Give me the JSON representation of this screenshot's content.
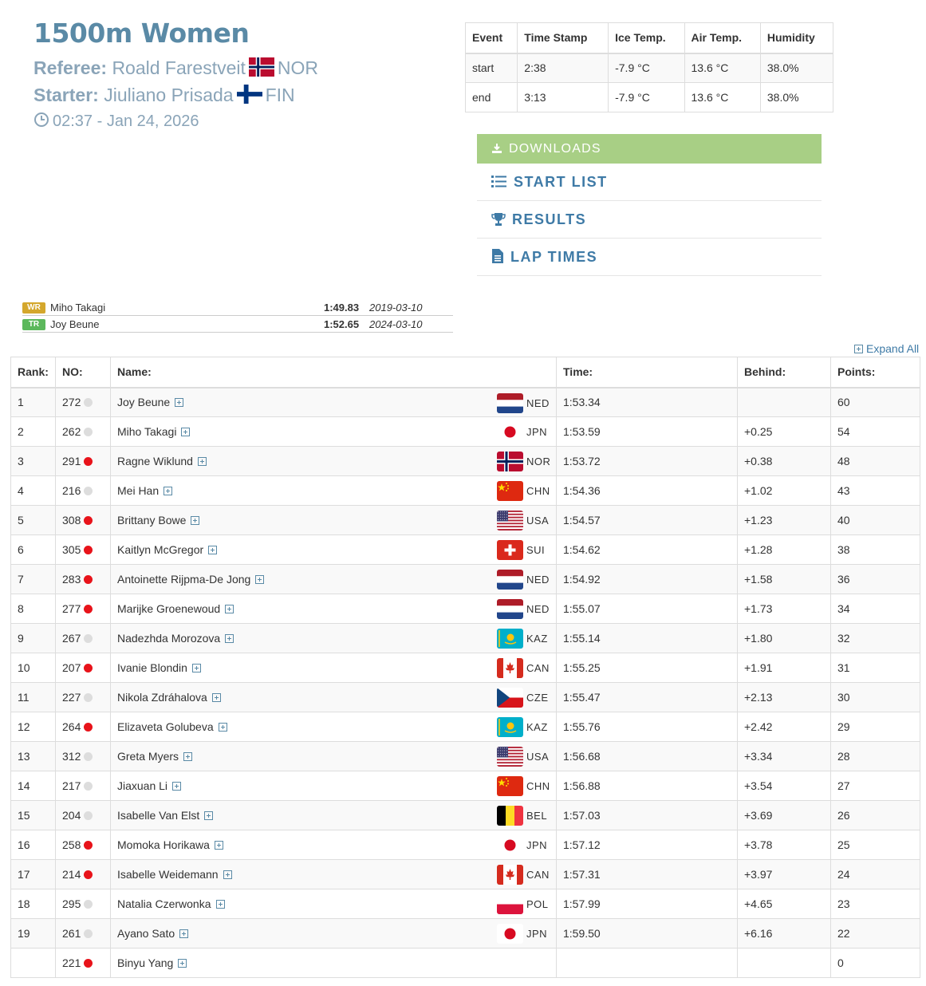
{
  "event": {
    "title": "1500m Women",
    "referee_label": "Referee:",
    "referee_name": "Roald Farestveit",
    "referee_country": "NOR",
    "starter_label": "Starter:",
    "starter_name": "Jiuliano Prisada",
    "starter_country": "FIN",
    "datetime": "02:37 - Jan 24, 2026"
  },
  "conditions": {
    "headers": [
      "Event",
      "Time Stamp",
      "Ice Temp.",
      "Air Temp.",
      "Humidity"
    ],
    "rows": [
      [
        "start",
        "2:38",
        "-7.9 °C",
        "13.6 °C",
        "38.0%"
      ],
      [
        "end",
        "3:13",
        "-7.9 °C",
        "13.6 °C",
        "38.0%"
      ]
    ]
  },
  "downloads": {
    "title": "DOWNLOADS",
    "start_list": "START LIST",
    "results": "RESULTS",
    "lap_times": "LAP TIMES"
  },
  "records": [
    {
      "badge": "WR",
      "color": "#d4a72c",
      "name": "Miho Takagi",
      "time": "1:49.83",
      "date": "2019-03-10"
    },
    {
      "badge": "TR",
      "color": "#5cb85c",
      "name": "Joy Beune",
      "time": "1:52.65",
      "date": "2024-03-10"
    }
  ],
  "expand_all": "Expand All",
  "results": {
    "headers": {
      "rank": "Rank:",
      "no": "NO:",
      "name": "Name:",
      "time": "Time:",
      "behind": "Behind:",
      "points": "Points:"
    },
    "rows": [
      {
        "rank": "1",
        "no": "272",
        "dot": "#dddddd",
        "name": "Joy Beune",
        "flag": "NED",
        "country": "NED",
        "time": "1:53.34",
        "behind": "",
        "points": "60"
      },
      {
        "rank": "2",
        "no": "262",
        "dot": "#dddddd",
        "name": "Miho Takagi",
        "flag": "JPN",
        "country": "JPN",
        "time": "1:53.59",
        "behind": "+0.25",
        "points": "54"
      },
      {
        "rank": "3",
        "no": "291",
        "dot": "#e8131a",
        "name": "Ragne Wiklund",
        "flag": "NOR",
        "country": "NOR",
        "time": "1:53.72",
        "behind": "+0.38",
        "points": "48"
      },
      {
        "rank": "4",
        "no": "216",
        "dot": "#dddddd",
        "name": "Mei Han",
        "flag": "CHN",
        "country": "CHN",
        "time": "1:54.36",
        "behind": "+1.02",
        "points": "43"
      },
      {
        "rank": "5",
        "no": "308",
        "dot": "#e8131a",
        "name": "Brittany Bowe",
        "flag": "USA",
        "country": "USA",
        "time": "1:54.57",
        "behind": "+1.23",
        "points": "40"
      },
      {
        "rank": "6",
        "no": "305",
        "dot": "#e8131a",
        "name": "Kaitlyn McGregor",
        "flag": "SUI",
        "country": "SUI",
        "time": "1:54.62",
        "behind": "+1.28",
        "points": "38"
      },
      {
        "rank": "7",
        "no": "283",
        "dot": "#e8131a",
        "name": "Antoinette Rijpma-De Jong",
        "flag": "NED",
        "country": "NED",
        "time": "1:54.92",
        "behind": "+1.58",
        "points": "36"
      },
      {
        "rank": "8",
        "no": "277",
        "dot": "#e8131a",
        "name": "Marijke Groenewoud",
        "flag": "NED",
        "country": "NED",
        "time": "1:55.07",
        "behind": "+1.73",
        "points": "34"
      },
      {
        "rank": "9",
        "no": "267",
        "dot": "#dddddd",
        "name": "Nadezhda Morozova",
        "flag": "KAZ",
        "country": "KAZ",
        "time": "1:55.14",
        "behind": "+1.80",
        "points": "32"
      },
      {
        "rank": "10",
        "no": "207",
        "dot": "#e8131a",
        "name": "Ivanie Blondin",
        "flag": "CAN",
        "country": "CAN",
        "time": "1:55.25",
        "behind": "+1.91",
        "points": "31"
      },
      {
        "rank": "11",
        "no": "227",
        "dot": "#dddddd",
        "name": "Nikola Zdráhalova",
        "flag": "CZE",
        "country": "CZE",
        "time": "1:55.47",
        "behind": "+2.13",
        "points": "30"
      },
      {
        "rank": "12",
        "no": "264",
        "dot": "#e8131a",
        "name": "Elizaveta Golubeva",
        "flag": "KAZ",
        "country": "KAZ",
        "time": "1:55.76",
        "behind": "+2.42",
        "points": "29"
      },
      {
        "rank": "13",
        "no": "312",
        "dot": "#dddddd",
        "name": "Greta Myers",
        "flag": "USA",
        "country": "USA",
        "time": "1:56.68",
        "behind": "+3.34",
        "points": "28"
      },
      {
        "rank": "14",
        "no": "217",
        "dot": "#dddddd",
        "name": "Jiaxuan Li",
        "flag": "CHN",
        "country": "CHN",
        "time": "1:56.88",
        "behind": "+3.54",
        "points": "27"
      },
      {
        "rank": "15",
        "no": "204",
        "dot": "#dddddd",
        "name": "Isabelle Van Elst",
        "flag": "BEL",
        "country": "BEL",
        "time": "1:57.03",
        "behind": "+3.69",
        "points": "26"
      },
      {
        "rank": "16",
        "no": "258",
        "dot": "#e8131a",
        "name": "Momoka Horikawa",
        "flag": "JPN",
        "country": "JPN",
        "time": "1:57.12",
        "behind": "+3.78",
        "points": "25"
      },
      {
        "rank": "17",
        "no": "214",
        "dot": "#e8131a",
        "name": "Isabelle Weidemann",
        "flag": "CAN",
        "country": "CAN",
        "time": "1:57.31",
        "behind": "+3.97",
        "points": "24"
      },
      {
        "rank": "18",
        "no": "295",
        "dot": "#dddddd",
        "name": "Natalia Czerwonka",
        "flag": "POL",
        "country": "POL",
        "time": "1:57.99",
        "behind": "+4.65",
        "points": "23"
      },
      {
        "rank": "19",
        "no": "261",
        "dot": "#dddddd",
        "name": "Ayano Sato",
        "flag": "JPN",
        "country": "JPN",
        "time": "1:59.50",
        "behind": "+6.16",
        "points": "22"
      },
      {
        "rank": "",
        "no": "221",
        "dot": "#e8131a",
        "name": "Binyu Yang",
        "flag": "",
        "country": "",
        "time": "",
        "behind": "",
        "points": "0"
      }
    ]
  }
}
